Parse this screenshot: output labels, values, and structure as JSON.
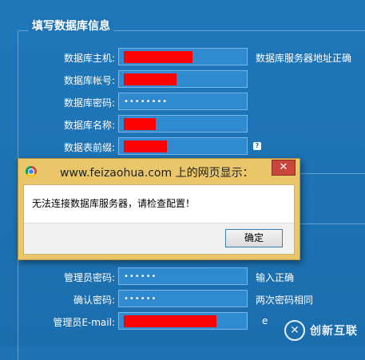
{
  "section1": {
    "title": "填写数据库信息",
    "fields": [
      {
        "label": "数据库主机:",
        "hint": "数据库服务器地址正确"
      },
      {
        "label": "数据库帐号:"
      },
      {
        "label": "数据库密码:",
        "masked": "••••••••"
      },
      {
        "label": "数据库名称:"
      },
      {
        "label": "数据表前缀:"
      }
    ]
  },
  "section2": {
    "fields": [
      {
        "label": "管理员密码:",
        "masked": "••••••",
        "hint": "输入正确"
      },
      {
        "label": "确认密码:",
        "masked": "••••••",
        "hint": "两次密码相同"
      },
      {
        "label": "管理员E-mail:",
        "hint": "e"
      }
    ]
  },
  "dialog": {
    "title": "www.feizaohua.com 上的网页显示：",
    "message": "无法连接数据库服务器，请检查配置！",
    "ok_label": "确定",
    "close_glyph": "✕"
  },
  "help_glyph": "?",
  "watermark": {
    "logo_glyph": "✕",
    "text": "创新互联"
  },
  "colors": {
    "background": "#1e73b4",
    "redaction": "#ff0000",
    "dialog_frame": "#e9c66a"
  }
}
